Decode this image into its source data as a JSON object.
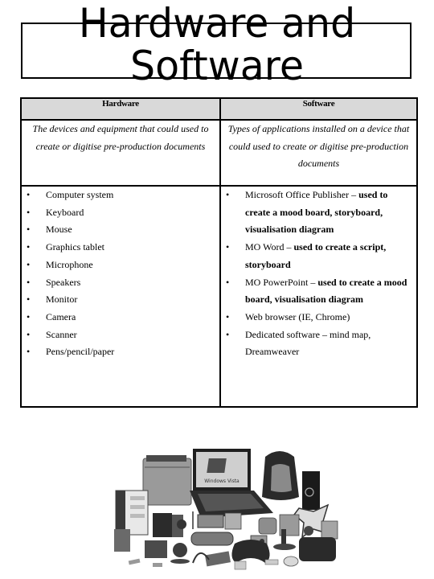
{
  "title": {
    "line1": "Hardware and",
    "line2": "Software"
  },
  "table": {
    "headers": [
      "Hardware",
      "Software"
    ],
    "descriptions": [
      "The devices and equipment that could used to create or digitise pre-production documents",
      "Types of applications installed on a device that could used to create or digitise pre-production documents"
    ],
    "hardware_items": [
      "Computer system",
      "Keyboard",
      "Mouse",
      "Graphics tablet",
      "Microphone",
      "Speakers",
      "Monitor",
      "Camera",
      "Scanner",
      "Pens/pencil/paper"
    ],
    "software_items": [
      {
        "name": "Microsoft Office Publisher – ",
        "use": "used to create a mood board, storyboard, visualisation diagram"
      },
      {
        "name": "MO Word – ",
        "use": "used to create a script, storyboard"
      },
      {
        "name": "MO PowerPoint – ",
        "use": "used to create a mood board, visualisation diagram"
      },
      {
        "name": "Web browser (IE, Chrome)",
        "use": ""
      },
      {
        "name": "Dedicated software – mind map, Dreamweaver",
        "use": ""
      }
    ],
    "bullet": "•"
  },
  "photo": {
    "alt": "Collection of computer hardware devices",
    "screen_text": "Windows Vista"
  }
}
